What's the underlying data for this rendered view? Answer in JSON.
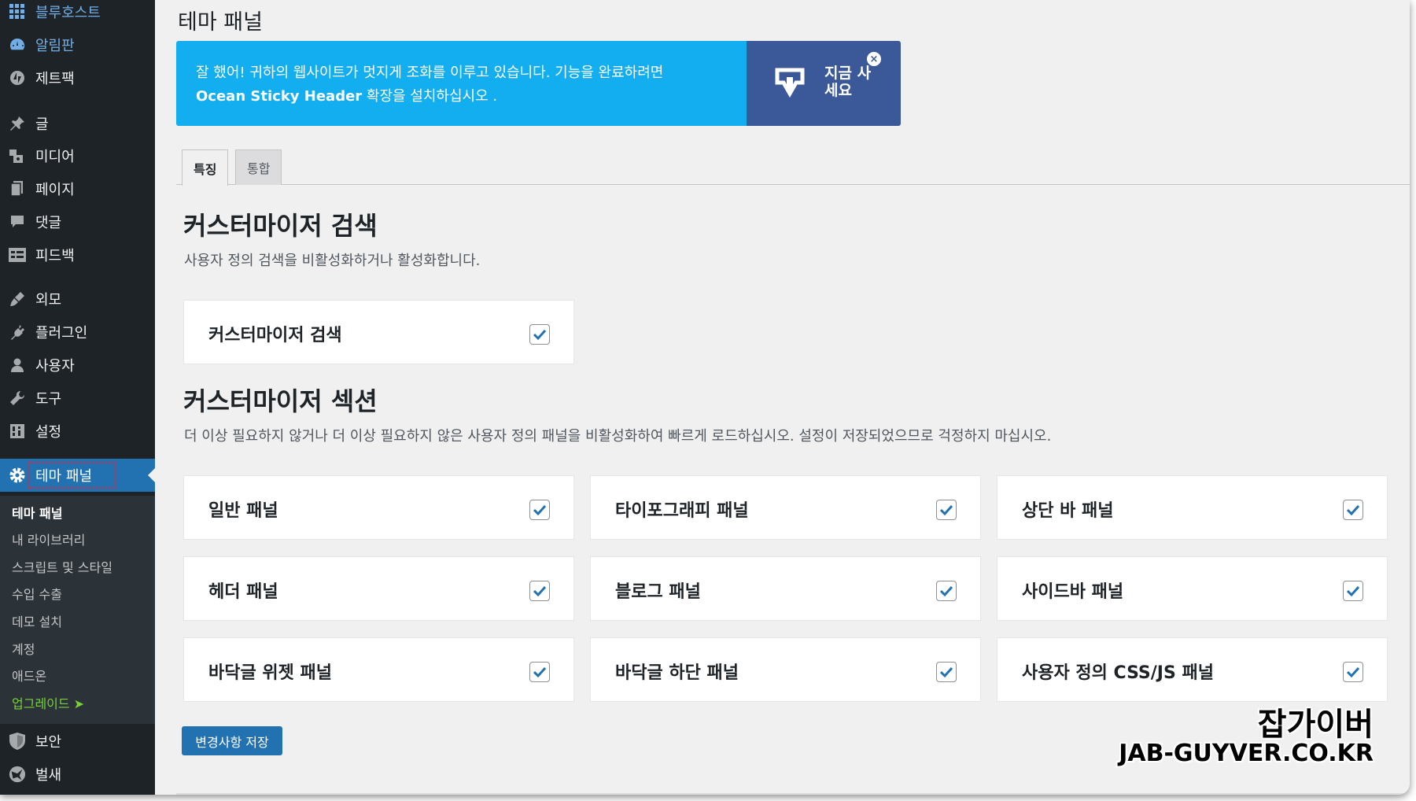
{
  "sidebar": {
    "top_items": [
      {
        "label": "블루호스트",
        "icon": "grid-icon"
      },
      {
        "label": "알림판",
        "icon": "dashboard-icon"
      },
      {
        "label": "제트팩",
        "icon": "jetpack-icon"
      },
      {
        "label": "글",
        "icon": "pin-icon"
      },
      {
        "label": "미디어",
        "icon": "media-icon"
      },
      {
        "label": "페이지",
        "icon": "page-icon"
      },
      {
        "label": "댓글",
        "icon": "comment-icon"
      },
      {
        "label": "피드백",
        "icon": "feedback-icon"
      },
      {
        "label": "외모",
        "icon": "brush-icon"
      },
      {
        "label": "플러그인",
        "icon": "plugin-icon"
      },
      {
        "label": "사용자",
        "icon": "user-icon"
      },
      {
        "label": "도구",
        "icon": "wrench-icon"
      },
      {
        "label": "설정",
        "icon": "settings-icon"
      }
    ],
    "active_item": {
      "label": "테마 패널",
      "icon": "gear-icon"
    },
    "submenu": [
      "테마 패널",
      "내 라이브러리",
      "스크립트 및 스타일",
      "수입 수출",
      "데모 설치",
      "계정",
      "애드온",
      "업그레이드 ➤"
    ],
    "bottom_items": [
      {
        "label": "보안",
        "icon": "shield-icon"
      },
      {
        "label": "벌새",
        "icon": "hummingbird-icon"
      }
    ]
  },
  "page": {
    "title": "테마 패널"
  },
  "promo": {
    "line1": "잘 했어! 귀하의 웹사이트가 멋지게 조화를 이루고 있습니다. 기능을 완료하려면",
    "product": "Ocean Sticky Header",
    "line2": " 확장을 설치하십시오 .",
    "buy_line1": "지금 사",
    "buy_line2": "세요",
    "close": "×",
    "colors": {
      "message_bg": "#13aeef",
      "button_bg": "#3b5998"
    }
  },
  "tabs": [
    {
      "label": "특징",
      "active": true
    },
    {
      "label": "통합",
      "active": false
    }
  ],
  "customizer_search": {
    "title": "커스터마이저 검색",
    "description": "사용자 정의 검색을 비활성화하거나 활성화합니다.",
    "option": {
      "label": "커스터마이저 검색",
      "checked": true
    }
  },
  "customizer_sections": {
    "title": "커스터마이저 섹션",
    "description": "더 이상 필요하지 않거나 더 이상 필요하지 않은 사용자 정의 패널을 비활성화하여 빠르게 로드하십시오. 설정이 저장되었으므로 걱정하지 마십시오.",
    "panels": [
      {
        "label": "일반 패널",
        "checked": true
      },
      {
        "label": "타이포그래피 패널",
        "checked": true
      },
      {
        "label": "상단 바 패널",
        "checked": true
      },
      {
        "label": "헤더 패널",
        "checked": true
      },
      {
        "label": "블로그 패널",
        "checked": true
      },
      {
        "label": "사이드바 패널",
        "checked": true
      },
      {
        "label": "바닥글 위젯 패널",
        "checked": true
      },
      {
        "label": "바닥글 하단 패널",
        "checked": true
      },
      {
        "label": "사용자 정의 CSS/JS 패널",
        "checked": true
      }
    ]
  },
  "save_button": "변경사항 저장",
  "watermark": {
    "korean": "잡가이버",
    "english": "JAB-GUYVER.CO.KR"
  },
  "colors": {
    "sidebar_bg": "#1d2327",
    "accent": "#2271b1",
    "checkbox_tick": "#2271b1",
    "upgrade_green": "#7ad03a"
  }
}
